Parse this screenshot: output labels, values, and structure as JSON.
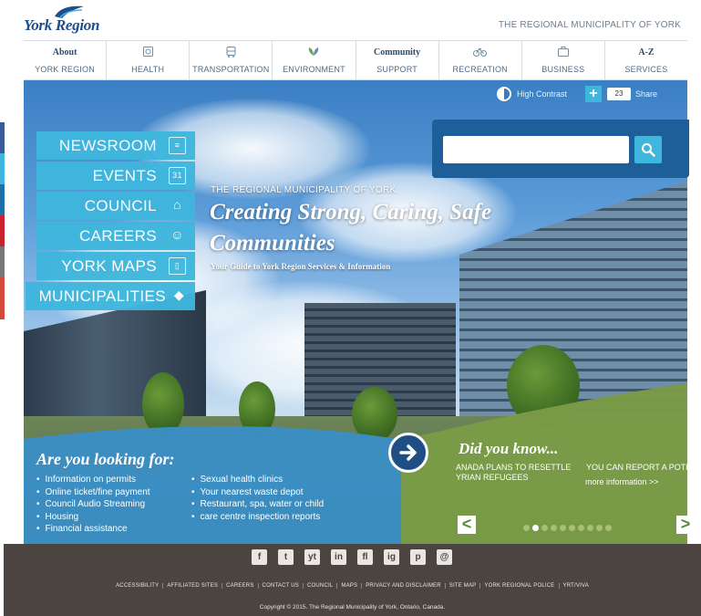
{
  "header": {
    "logo_text": "York Region",
    "tagline": "THE REGIONAL MUNICIPALITY OF YORK"
  },
  "nav": [
    {
      "top": "About",
      "label": "YORK REGION",
      "icon": ""
    },
    {
      "top": "",
      "label": "HEALTH",
      "icon": "health-icon"
    },
    {
      "top": "",
      "label": "TRANSPORTATION",
      "icon": "bus-icon"
    },
    {
      "top": "",
      "label": "ENVIRONMENT",
      "icon": "leaf-icon"
    },
    {
      "top": "Community",
      "label": "SUPPORT",
      "icon": ""
    },
    {
      "top": "",
      "label": "RECREATION",
      "icon": "bicycle-icon"
    },
    {
      "top": "",
      "label": "BUSINESS",
      "icon": "briefcase-icon"
    },
    {
      "top": "A-Z",
      "label": "SERVICES",
      "icon": ""
    }
  ],
  "side_menu": [
    {
      "label": "NEWSROOM",
      "icon": "newspaper-icon"
    },
    {
      "label": "EVENTS",
      "icon": "calendar-icon"
    },
    {
      "label": "COUNCIL",
      "icon": "building-icon"
    },
    {
      "label": "CAREERS",
      "icon": "people-icon"
    },
    {
      "label": "YORK MAPS",
      "icon": "map-icon"
    },
    {
      "label": "MUNICIPALITIES",
      "icon": "shield-icon"
    }
  ],
  "utility": {
    "contrast_label": "High Contrast",
    "share_count": "23",
    "share_label": "Share"
  },
  "search": {
    "placeholder": ""
  },
  "hero": {
    "kicker": "THE REGIONAL MUNICIPALITY OF YORK",
    "title_line1": "Creating Strong, Caring, Safe",
    "title_line2": "Communities",
    "subtitle": "Your Guide to York Region Services & Information"
  },
  "looking_for": {
    "title": "Are you looking for:",
    "col1": [
      "Information on permits",
      "Online ticket/fine payment",
      "Council Audio Streaming",
      "Housing",
      "Financial assistance"
    ],
    "col2": [
      "Sexual health clinics",
      "Your nearest waste depot",
      "Restaurant, spa, water or child",
      "care centre inspection reports"
    ]
  },
  "did_you_know": {
    "title": "Did you know...",
    "slide1_line1": "ANADA PLANS TO RESETTLE",
    "slide1_line2": "YRIAN REFUGEES",
    "slide2_line1": "YOU CAN REPORT A POTH",
    "more": "more information >>",
    "prev": "<",
    "next": ">",
    "dot_count": 10,
    "active_dot": 2
  },
  "footer": {
    "social": [
      "f",
      "t",
      "yt",
      "in",
      "fl",
      "ig",
      "p",
      "@"
    ],
    "links": [
      "ACCESSIBILITY",
      "AFFILIATED SITES",
      "CAREERS",
      "CONTACT US",
      "COUNCIL",
      "MAPS",
      "PRIVACY AND DISCLAIMER",
      "SITE MAP",
      "YORK REGIONAL POLICE",
      "YRT/VIVA"
    ],
    "copyright": "Copyright © 2015. The Regional Municipality of York, Ontario, Canada."
  },
  "colors": {
    "brand_blue": "#1f4e8c",
    "menu_cyan": "#3fb6dd",
    "search_panel": "#1f5f99",
    "looking_blue": "#3a8fc6",
    "dyk_green": "#7a9b46",
    "footer_brown": "#4b4440"
  }
}
